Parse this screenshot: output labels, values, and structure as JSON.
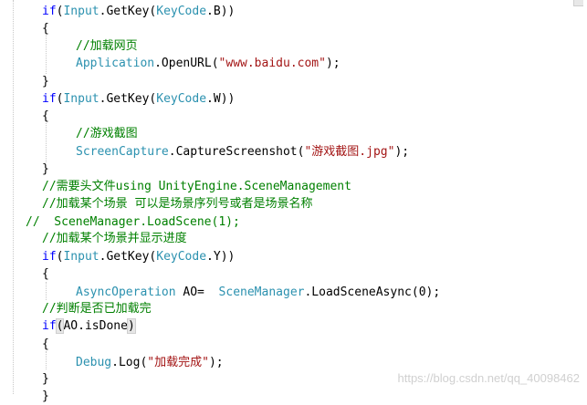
{
  "code_lines": [
    {
      "tokens": [
        {
          "t": "if",
          "c": "kw"
        },
        {
          "t": "(",
          "c": ""
        },
        {
          "t": "Input",
          "c": "ty"
        },
        {
          "t": ".GetKey(",
          "c": ""
        },
        {
          "t": "KeyCode",
          "c": "ty"
        },
        {
          "t": ".B))",
          "c": ""
        }
      ]
    },
    {
      "tokens": [
        {
          "t": "{",
          "c": ""
        }
      ]
    },
    {
      "tokens": [
        {
          "t": "//加载网页",
          "c": "cm"
        }
      ]
    },
    {
      "tokens": [
        {
          "t": "Application",
          "c": "ty"
        },
        {
          "t": ".OpenURL(",
          "c": ""
        },
        {
          "t": "\"www.baidu.com\"",
          "c": "st"
        },
        {
          "t": ");",
          "c": ""
        }
      ]
    },
    {
      "tokens": [
        {
          "t": "}",
          "c": ""
        }
      ]
    },
    {
      "tokens": [
        {
          "t": "if",
          "c": "kw"
        },
        {
          "t": "(",
          "c": ""
        },
        {
          "t": "Input",
          "c": "ty"
        },
        {
          "t": ".GetKey(",
          "c": ""
        },
        {
          "t": "KeyCode",
          "c": "ty"
        },
        {
          "t": ".W))",
          "c": ""
        }
      ]
    },
    {
      "tokens": [
        {
          "t": "{",
          "c": ""
        }
      ]
    },
    {
      "tokens": [
        {
          "t": "//游戏截图",
          "c": "cm"
        }
      ]
    },
    {
      "tokens": [
        {
          "t": "ScreenCapture",
          "c": "ty"
        },
        {
          "t": ".CaptureScreenshot(",
          "c": ""
        },
        {
          "t": "\"游戏截图.jpg\"",
          "c": "st"
        },
        {
          "t": ");",
          "c": ""
        }
      ]
    },
    {
      "tokens": [
        {
          "t": "}",
          "c": ""
        }
      ]
    },
    {
      "tokens": [
        {
          "t": "//需要头文件using UnityEngine.SceneManagement",
          "c": "cm"
        }
      ]
    },
    {
      "tokens": [
        {
          "t": "//加载某个场景 可以是场景序列号或者是场景名称",
          "c": "cm"
        }
      ]
    },
    {
      "tokens": [
        {
          "t": "//  SceneManager.LoadScene(1);",
          "c": "cm"
        }
      ]
    },
    {
      "tokens": [
        {
          "t": "//加载某个场景并显示进度",
          "c": "cm"
        }
      ]
    },
    {
      "tokens": [
        {
          "t": "if",
          "c": "kw"
        },
        {
          "t": "(",
          "c": ""
        },
        {
          "t": "Input",
          "c": "ty"
        },
        {
          "t": ".GetKey(",
          "c": ""
        },
        {
          "t": "KeyCode",
          "c": "ty"
        },
        {
          "t": ".Y))",
          "c": ""
        }
      ]
    },
    {
      "tokens": [
        {
          "t": "{",
          "c": ""
        }
      ]
    },
    {
      "tokens": [
        {
          "t": "AsyncOperation",
          "c": "ty"
        },
        {
          "t": " AO=  ",
          "c": ""
        },
        {
          "t": "SceneManager",
          "c": "ty"
        },
        {
          "t": ".LoadSceneAsync(0);",
          "c": ""
        }
      ]
    },
    {
      "tokens": [
        {
          "t": "//判断是否已加载完",
          "c": "cm"
        }
      ]
    },
    {
      "tokens": [
        {
          "t": "if",
          "c": "kw"
        },
        {
          "t": "(",
          "c": "br"
        },
        {
          "t": "AO.isDone",
          "c": ""
        },
        {
          "t": ")",
          "c": "br"
        }
      ]
    },
    {
      "tokens": [
        {
          "t": "{",
          "c": ""
        }
      ]
    },
    {
      "tokens": [
        {
          "t": "Debug",
          "c": "ty"
        },
        {
          "t": ".Log(",
          "c": ""
        },
        {
          "t": "\"加载完成\"",
          "c": "st"
        },
        {
          "t": ");",
          "c": ""
        }
      ]
    },
    {
      "tokens": [
        {
          "t": "}",
          "c": ""
        }
      ]
    },
    {
      "tokens": [
        {
          "t": "}",
          "c": ""
        }
      ]
    }
  ],
  "watermark": "https://blog.csdn.net/qq_40098462",
  "colors": {
    "keyword": "#0000ff",
    "type": "#2b91af",
    "string": "#a31515",
    "comment": "#008000",
    "text": "#000000",
    "background": "#ffffff"
  }
}
